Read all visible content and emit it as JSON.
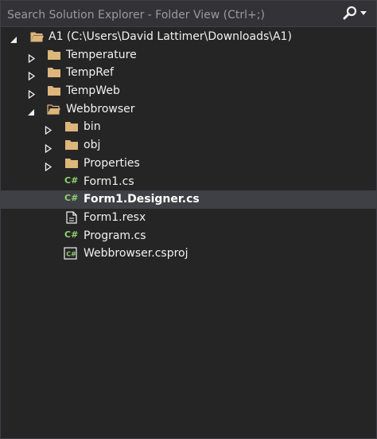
{
  "search": {
    "placeholder": "Search Solution Explorer - Folder View (Ctrl+;)"
  },
  "tree": {
    "root": {
      "label": "A1 (C:\\Users\\David Lattimer\\Downloads\\A1)",
      "expanded": true,
      "icon": "folder-open-icon"
    },
    "items": [
      {
        "label": "Temperature",
        "icon": "folder-icon",
        "expander": "collapsed"
      },
      {
        "label": "TempRef",
        "icon": "folder-icon",
        "expander": "collapsed"
      },
      {
        "label": "TempWeb",
        "icon": "folder-icon",
        "expander": "collapsed"
      },
      {
        "label": "Webbrowser",
        "icon": "folder-open-icon",
        "expander": "expanded"
      },
      {
        "label": "bin",
        "icon": "folder-icon",
        "expander": "collapsed"
      },
      {
        "label": "obj",
        "icon": "folder-icon",
        "expander": "collapsed"
      },
      {
        "label": "Properties",
        "icon": "folder-icon",
        "expander": "collapsed"
      },
      {
        "label": "Form1.cs",
        "icon": "csharp-file-icon"
      },
      {
        "label": "Form1.Designer.cs",
        "icon": "csharp-file-icon",
        "selected": true
      },
      {
        "label": "Form1.resx",
        "icon": "resx-file-icon"
      },
      {
        "label": "Program.cs",
        "icon": "csharp-file-icon"
      },
      {
        "label": "Webbrowser.csproj",
        "icon": "csproj-file-icon"
      }
    ]
  },
  "colors": {
    "background": "#252526",
    "search_bg": "#333337",
    "selected_row": "#3f3f46",
    "folder": "#dcb67a",
    "csharp": "#8fd16e",
    "text": "#f1f1f1"
  }
}
